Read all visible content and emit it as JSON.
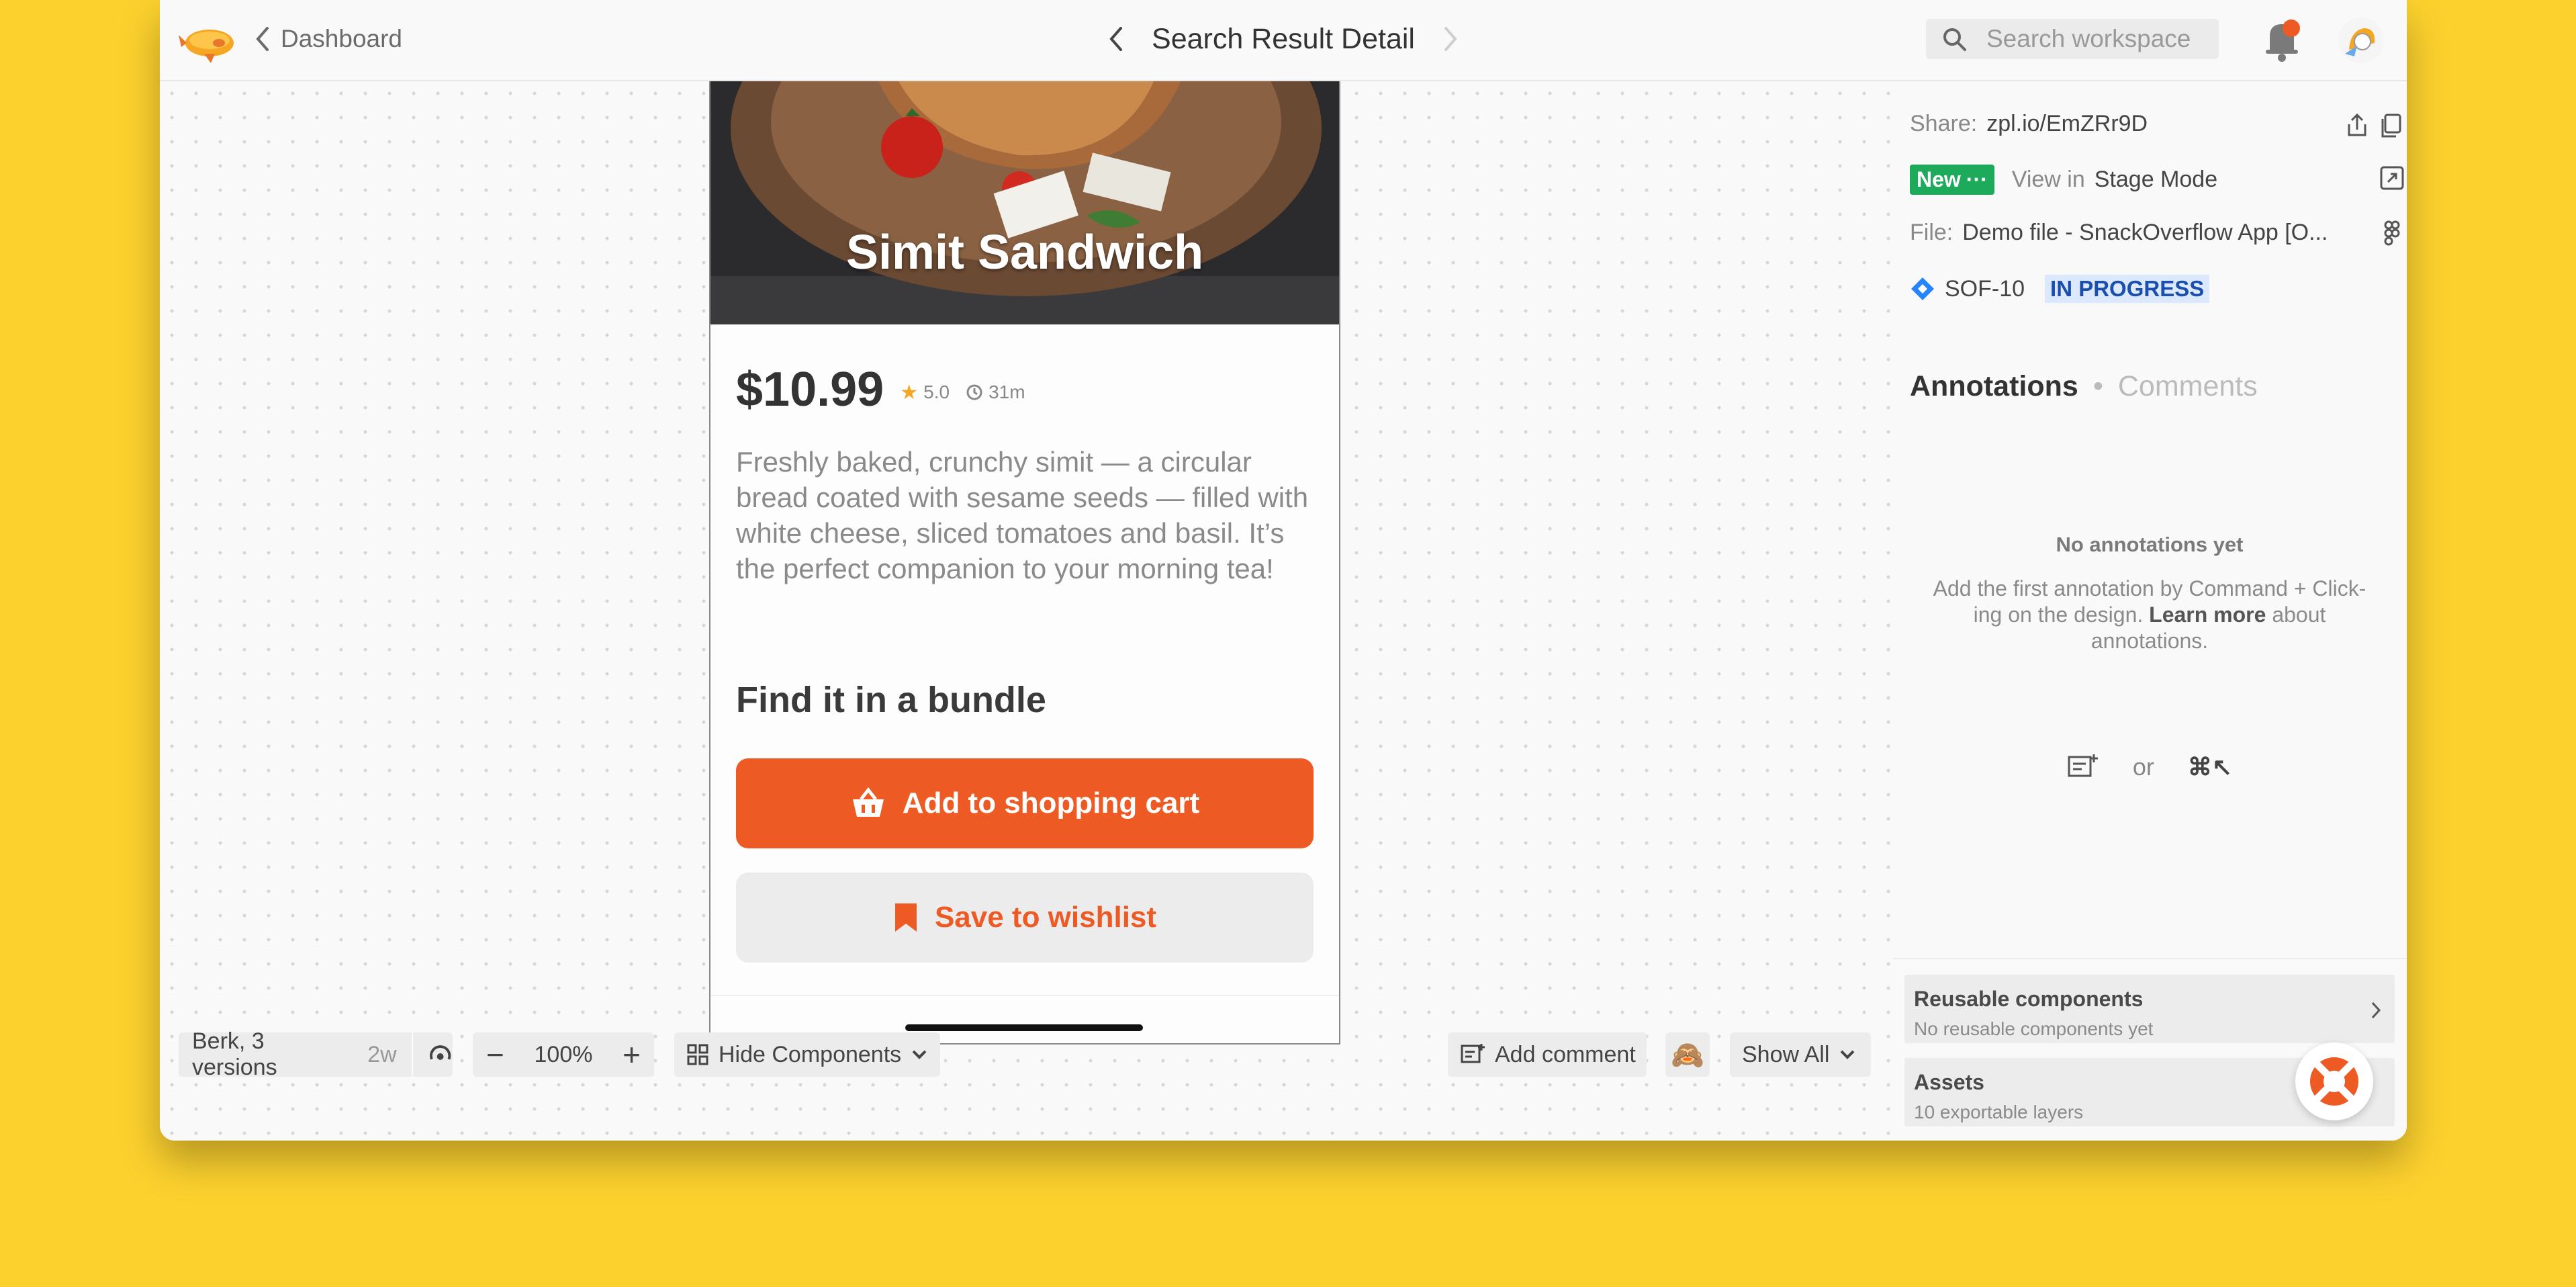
{
  "topbar": {
    "back_label": "Dashboard",
    "title": "Search Result Detail",
    "search_placeholder": "Search workspace"
  },
  "screen": {
    "hero_title": "Simit Sandwich",
    "price": "$10.99",
    "rating": "5.0",
    "time": "31m",
    "description": "Freshly baked, crunchy simit — a circular bread coated with sesame seeds — filled with white cheese, sliced tomatoes and basil. It’s the perfect companion to your morning tea!",
    "bundle_heading": "Find it in a bundle",
    "cart_button": "Add to shopping cart",
    "wishlist_button": "Save to wishlist"
  },
  "toolbar": {
    "versions": "Berk, 3 versions",
    "age": "2w",
    "zoom": "100%",
    "hide_components": "Hide Components",
    "add_comment": "Add comment",
    "show_all": "Show All"
  },
  "panel": {
    "share_label": "Share:",
    "share_link": "zpl.io/EmZRr9D",
    "new_badge": "New",
    "view_in_label": "View in",
    "stage_mode": "Stage Mode",
    "file_label": "File:",
    "file_name": "Demo file - SnackOverflow App [O...",
    "jira_key": "SOF-10",
    "jira_status": "IN PROGRESS",
    "tab_annotations": "Annotations",
    "tab_comments": "Comments",
    "empty_title": "No annotations yet",
    "empty_desc_1": "Add the first annotation by Command + Click-ing on the design.",
    "empty_desc_link": "Learn more",
    "empty_desc_2": "about annotations.",
    "or_label": "or",
    "shortcut": "⌘↖",
    "reusable_title": "Reusable components",
    "reusable_sub": "No reusable components yet",
    "assets_title": "Assets",
    "assets_sub": "10 exportable layers"
  },
  "colors": {
    "background": "#FCD12E",
    "accent_orange": "#EE5A24",
    "new_badge": "#1DAA5B",
    "status_blue": "#1A4FAE"
  }
}
